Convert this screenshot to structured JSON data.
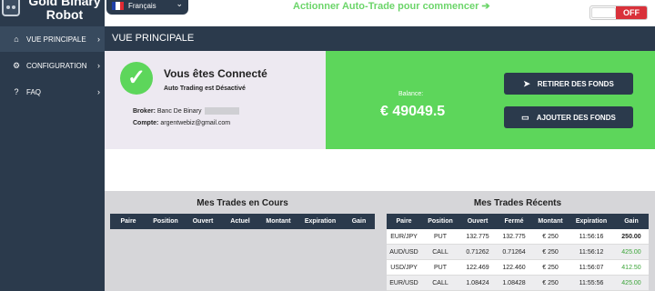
{
  "logo": {
    "line1": "Gold Binary",
    "line2": "Robot"
  },
  "language": {
    "label": "Français"
  },
  "cta": "Actionner Auto-Trade pour commencer ➔",
  "toggle": {
    "state": "OFF"
  },
  "nav": {
    "items": [
      {
        "label": "VUE PRINCIPALE",
        "icon": "home-icon"
      },
      {
        "label": "CONFIGURATION",
        "icon": "gear-icon"
      },
      {
        "label": "FAQ",
        "icon": "question-icon"
      }
    ]
  },
  "page_title": "VUE PRINCIPALE",
  "status": {
    "title": "Vous êtes Connecté",
    "subtitle": "Auto Trading est Désactivé",
    "broker_label": "Broker:",
    "broker_value": "Banc De Binary",
    "account_label": "Compte:",
    "account_value": "argentwebiz@gmail.com"
  },
  "balance": {
    "label": "Balance:",
    "value": "€ 49049.5"
  },
  "buttons": {
    "withdraw": "RETIRER DES FONDS",
    "deposit": "AJOUTER DES FONDS"
  },
  "current_trades": {
    "title": "Mes Trades en Cours",
    "columns": [
      "Paire",
      "Position",
      "Ouvert",
      "Actuel",
      "Montant",
      "Expiration",
      "Gain"
    ]
  },
  "recent_trades": {
    "title": "Mes Trades Récents",
    "columns": [
      "Paire",
      "Position",
      "Ouvert",
      "Fermé",
      "Montant",
      "Expiration",
      "Gain"
    ],
    "rows": [
      [
        "EUR/JPY",
        "PUT",
        "132.775",
        "132.775",
        "€ 250",
        "11:56:16",
        "250.00"
      ],
      [
        "AUD/USD",
        "CALL",
        "0.71262",
        "0.71264",
        "€ 250",
        "11:56:12",
        "425.00"
      ],
      [
        "USD/JPY",
        "PUT",
        "122.469",
        "122.460",
        "€ 250",
        "11:56:07",
        "412.50"
      ],
      [
        "EUR/USD",
        "CALL",
        "1.08424",
        "1.08428",
        "€ 250",
        "11:55:56",
        "425.00"
      ]
    ]
  },
  "colors": {
    "dark": "#2b3a4c",
    "green": "#5dd65b",
    "red": "#d9313a"
  }
}
